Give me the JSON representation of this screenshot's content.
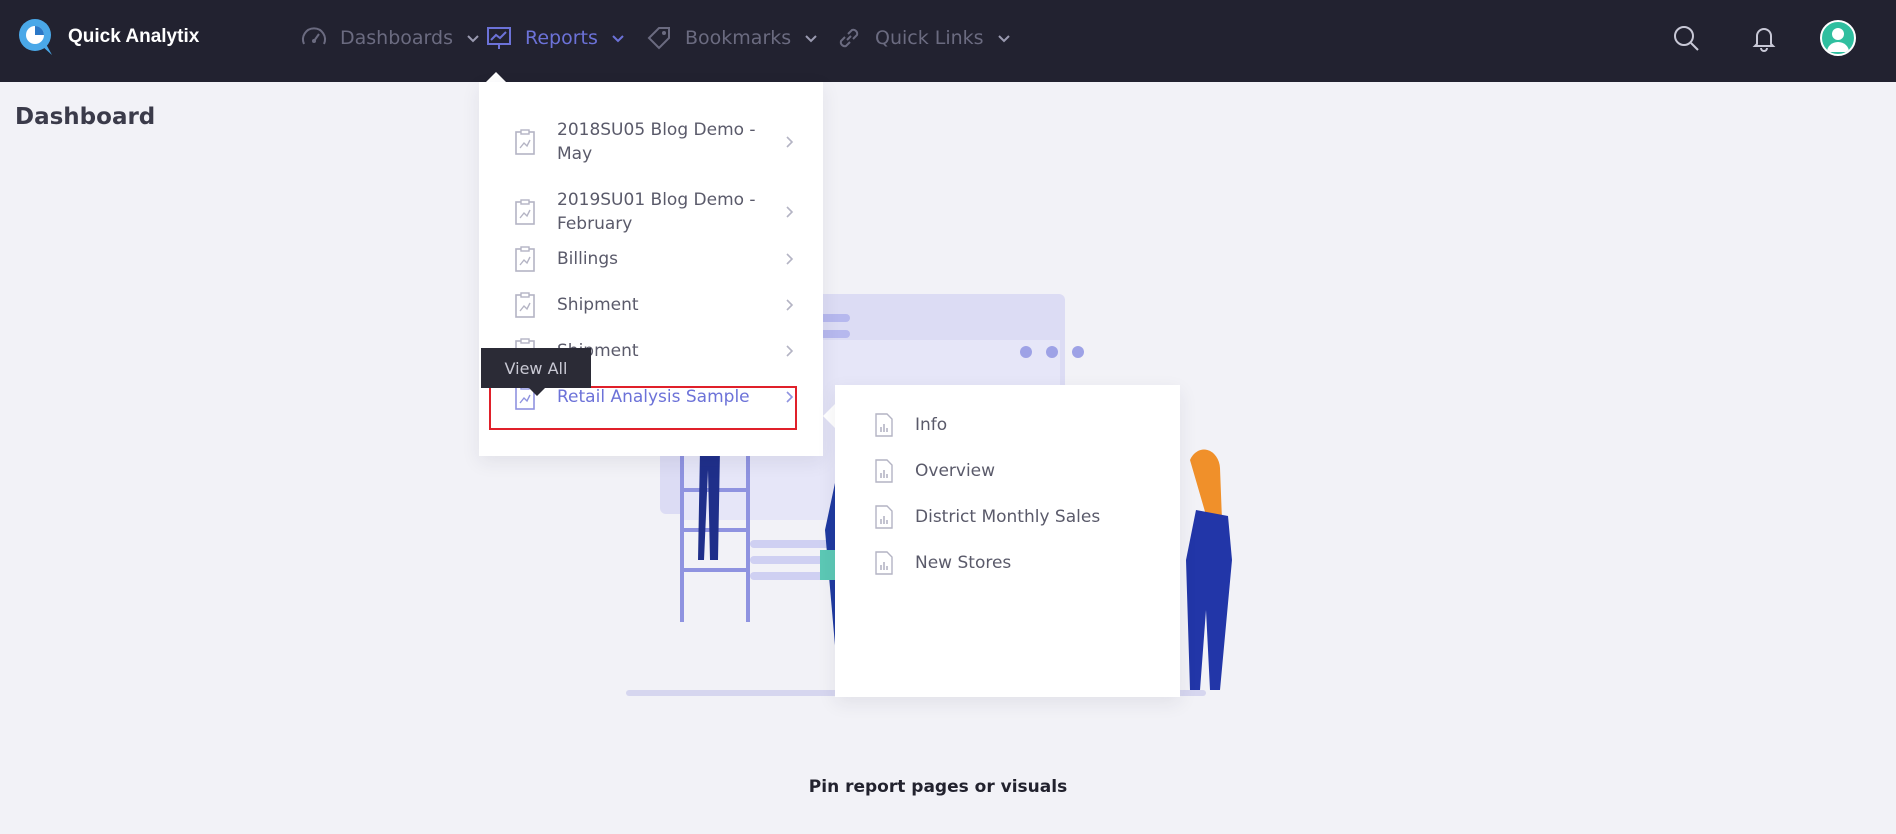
{
  "brand": {
    "name": "Quick Analytix"
  },
  "nav": {
    "items": [
      {
        "label": "Dashboards",
        "icon": "speedometer-icon"
      },
      {
        "label": "Reports",
        "icon": "report-chart-icon",
        "active": true
      },
      {
        "label": "Bookmarks",
        "icon": "tag-icon"
      },
      {
        "label": "Quick Links",
        "icon": "link-icon"
      }
    ],
    "right_icons": [
      "search-icon",
      "bell-icon",
      "user-avatar-icon"
    ]
  },
  "page": {
    "title": "Dashboard"
  },
  "reports_menu": {
    "items": [
      {
        "label": "2018SU05 Blog Demo - May"
      },
      {
        "label": "2019SU01 Blog Demo - February"
      },
      {
        "label": "Billings"
      },
      {
        "label": "Shipment"
      },
      {
        "label": "Shipment"
      },
      {
        "label": "Retail Analysis Sample",
        "selected": true
      }
    ],
    "tooltip": "View All"
  },
  "report_pages": {
    "items": [
      {
        "label": "Info"
      },
      {
        "label": "Overview"
      },
      {
        "label": "District Monthly Sales"
      },
      {
        "label": "New Stores"
      }
    ]
  },
  "empty_state": {
    "caption": "Pin report pages or visuals"
  },
  "colors": {
    "topbar": "#222230",
    "accent": "#6c72d8",
    "highlight": "#e0202a",
    "avatar": "#2fbf9f"
  }
}
